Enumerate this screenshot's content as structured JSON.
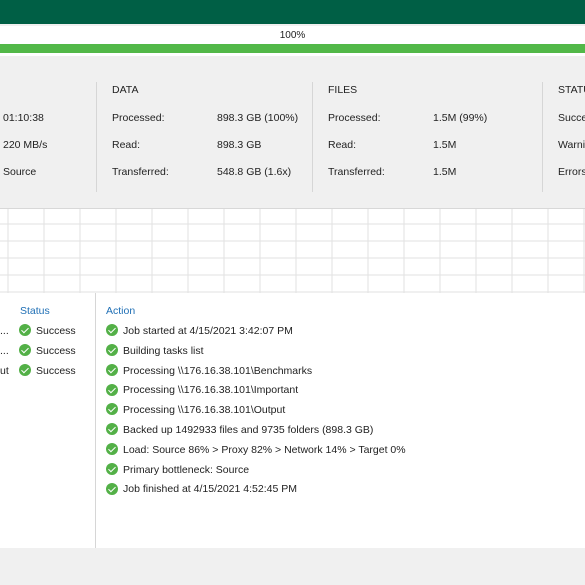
{
  "progress": {
    "percent_label": "100%",
    "fraction": 1.0
  },
  "summary": {
    "duration": "01:10:38",
    "rate": "220 MB/s",
    "bottleneck": "Source"
  },
  "data_section": {
    "header": "DATA",
    "rows": [
      {
        "label": "Processed:",
        "value": "898.3 GB (100%)"
      },
      {
        "label": "Read:",
        "value": "898.3 GB"
      },
      {
        "label": "Transferred:",
        "value": "548.8 GB (1.6x)"
      }
    ]
  },
  "files_section": {
    "header": "FILES",
    "rows": [
      {
        "label": "Processed:",
        "value": "1.5M (99%)"
      },
      {
        "label": "Read:",
        "value": "1.5M"
      },
      {
        "label": "Transferred:",
        "value": "1.5M"
      }
    ]
  },
  "status_section": {
    "header": "STATU",
    "rows": [
      {
        "label": "Succe"
      },
      {
        "label": "Warni"
      },
      {
        "label": "Errors"
      }
    ]
  },
  "objects": {
    "status_header": "Status",
    "rows": [
      {
        "name_tail": "...",
        "status": "Success"
      },
      {
        "name_tail": "...",
        "status": "Success"
      },
      {
        "name_tail": "ut",
        "status": "Success"
      }
    ]
  },
  "actions": {
    "header": "Action",
    "lines": [
      "Job started at 4/15/2021 3:42:07 PM",
      "Building tasks list",
      "Processing \\\\176.16.38.101\\Benchmarks",
      "Processing \\\\176.16.38.101\\Important",
      "Processing \\\\176.16.38.101\\Output",
      "Backed up 1492933 files and 9735 folders (898.3 GB)",
      "Load: Source 86% > Proxy 82% > Network 14% > Target 0%",
      "Primary bottleneck: Source",
      "Job finished at 4/15/2021 4:52:45 PM"
    ]
  },
  "colors": {
    "titlebar": "#005f45",
    "progress_fill": "#52b848",
    "success_icon": "#53b047",
    "header_blue": "#1f6fb5"
  }
}
